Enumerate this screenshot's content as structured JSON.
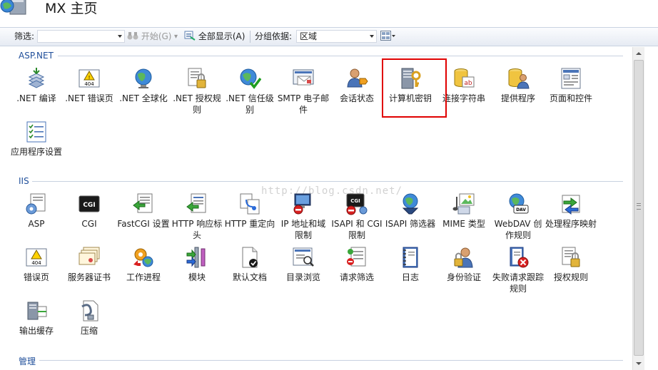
{
  "header": {
    "title": "MX 主页"
  },
  "toolbar": {
    "filter_label": "筛选:",
    "filter_value": "",
    "start_label": "开始(G)",
    "show_all_label": "全部显示(A)",
    "group_label": "分组依据:",
    "group_value": "区域"
  },
  "sections": {
    "aspnet": "ASP.NET",
    "iis": "IIS",
    "manage": "管理"
  },
  "aspnet_items": [
    {
      "label": ".NET 编译",
      "icon": "dotnet-compile-icon"
    },
    {
      "label": ".NET 错误页",
      "icon": "dotnet-error-page-icon"
    },
    {
      "label": ".NET 全球化",
      "icon": "dotnet-globalization-icon"
    },
    {
      "label": ".NET 授权规则",
      "icon": "dotnet-authorization-icon"
    },
    {
      "label": ".NET 信任级别",
      "icon": "dotnet-trust-level-icon"
    },
    {
      "label": "SMTP 电子邮件",
      "icon": "smtp-email-icon"
    },
    {
      "label": "会话状态",
      "icon": "session-state-icon"
    },
    {
      "label": "计算机密钥",
      "icon": "machine-key-icon"
    },
    {
      "label": "连接字符串",
      "icon": "connection-strings-icon"
    },
    {
      "label": "提供程序",
      "icon": "providers-icon"
    },
    {
      "label": "页面和控件",
      "icon": "pages-controls-icon"
    },
    {
      "label": "应用程序设置",
      "icon": "app-settings-icon"
    }
  ],
  "iis_items": [
    {
      "label": "ASP",
      "icon": "asp-icon"
    },
    {
      "label": "CGI",
      "icon": "cgi-icon"
    },
    {
      "label": "FastCGI 设置",
      "icon": "fastcgi-icon"
    },
    {
      "label": "HTTP 响应标头",
      "icon": "http-headers-icon"
    },
    {
      "label": "HTTP 重定向",
      "icon": "http-redirect-icon"
    },
    {
      "label": "IP 地址和域限制",
      "icon": "ip-restrictions-icon"
    },
    {
      "label": "ISAPI 和 CGI 限制",
      "icon": "isapi-cgi-icon"
    },
    {
      "label": "ISAPI 筛选器",
      "icon": "isapi-filters-icon"
    },
    {
      "label": "MIME 类型",
      "icon": "mime-types-icon"
    },
    {
      "label": "WebDAV 创作规则",
      "icon": "webdav-icon"
    },
    {
      "label": "处理程序映射",
      "icon": "handler-mappings-icon"
    },
    {
      "label": "错误页",
      "icon": "error-pages-icon"
    },
    {
      "label": "服务器证书",
      "icon": "server-certificates-icon"
    },
    {
      "label": "工作进程",
      "icon": "worker-processes-icon"
    },
    {
      "label": "模块",
      "icon": "modules-icon"
    },
    {
      "label": "默认文档",
      "icon": "default-document-icon"
    },
    {
      "label": "目录浏览",
      "icon": "directory-browsing-icon"
    },
    {
      "label": "请求筛选",
      "icon": "request-filtering-icon"
    },
    {
      "label": "日志",
      "icon": "logging-icon"
    },
    {
      "label": "身份验证",
      "icon": "authentication-icon"
    },
    {
      "label": "失败请求跟踪规则",
      "icon": "failed-request-tracing-icon"
    },
    {
      "label": "授权规则",
      "icon": "authorization-rules-icon"
    },
    {
      "label": "输出缓存",
      "icon": "output-caching-icon"
    },
    {
      "label": "压缩",
      "icon": "compression-icon"
    }
  ],
  "watermark": "http://blog.csdn.net/",
  "colors": {
    "accent": "#1f4e9a",
    "highlight": "#e00000"
  }
}
